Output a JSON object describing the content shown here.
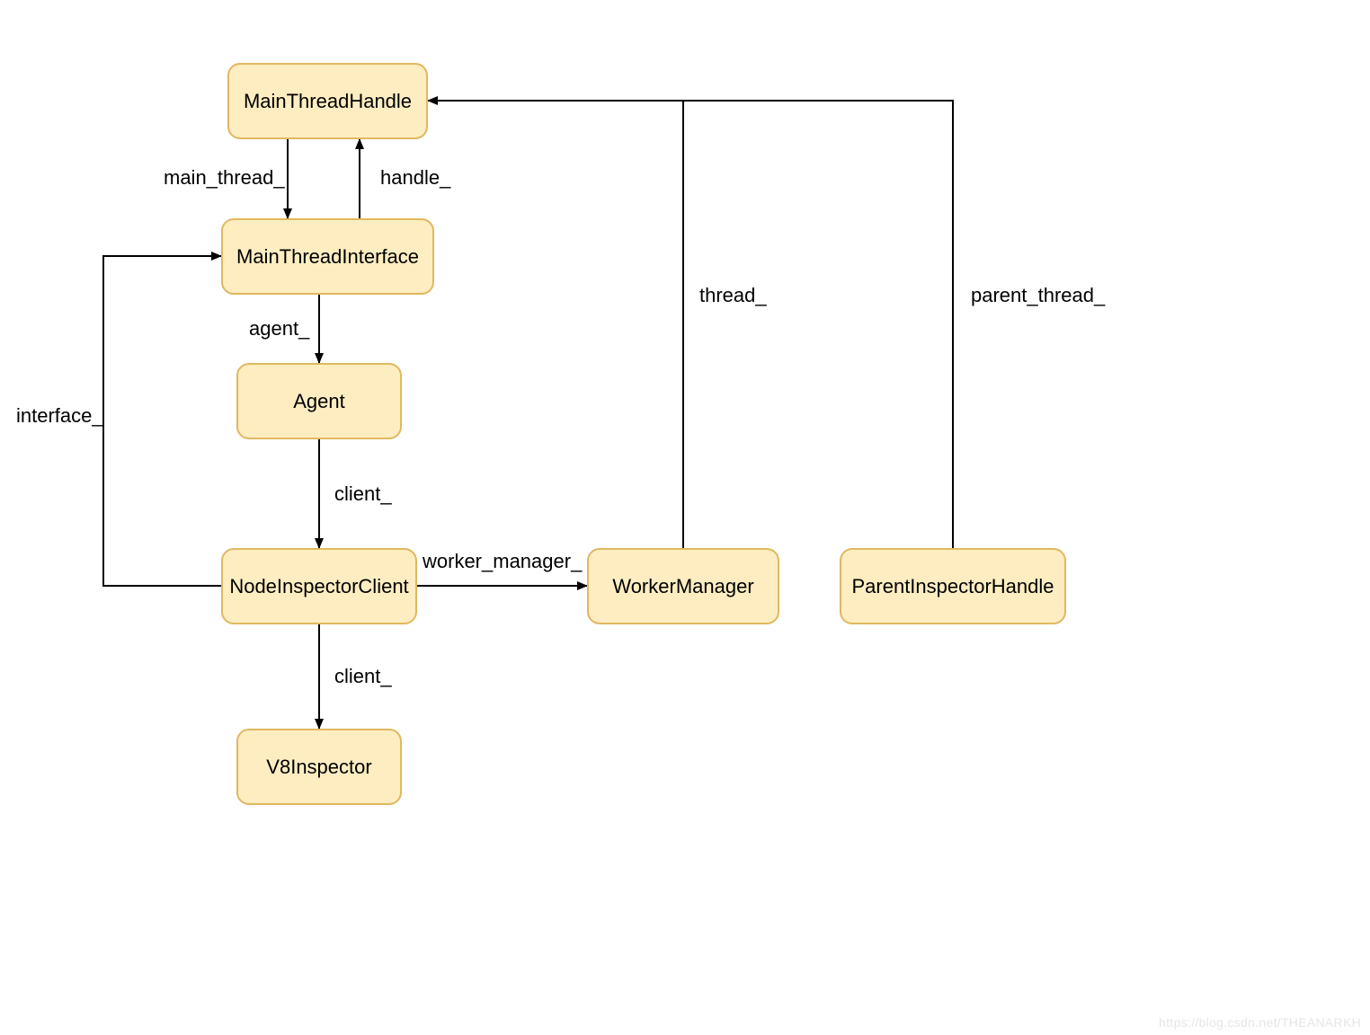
{
  "chart_data": {
    "type": "diagram",
    "title": "",
    "nodes": [
      {
        "id": "MainThreadHandle",
        "label": "MainThreadHandle"
      },
      {
        "id": "MainThreadInterface",
        "label": "MainThreadInterface"
      },
      {
        "id": "Agent",
        "label": "Agent"
      },
      {
        "id": "NodeInspectorClient",
        "label": "NodeInspectorClient"
      },
      {
        "id": "V8Inspector",
        "label": "V8Inspector"
      },
      {
        "id": "WorkerManager",
        "label": "WorkerManager"
      },
      {
        "id": "ParentInspectorHandle",
        "label": "ParentInspectorHandle"
      }
    ],
    "edges": [
      {
        "from": "MainThreadHandle",
        "to": "MainThreadInterface",
        "label": "main_thread_"
      },
      {
        "from": "MainThreadInterface",
        "to": "MainThreadHandle",
        "label": "handle_"
      },
      {
        "from": "MainThreadInterface",
        "to": "Agent",
        "label": "agent_"
      },
      {
        "from": "Agent",
        "to": "NodeInspectorClient",
        "label": "client_"
      },
      {
        "from": "NodeInspectorClient",
        "to": "MainThreadInterface",
        "label": "interface_"
      },
      {
        "from": "NodeInspectorClient",
        "to": "WorkerManager",
        "label": "worker_manager_"
      },
      {
        "from": "NodeInspectorClient",
        "to": "V8Inspector",
        "label": "client_"
      },
      {
        "from": "WorkerManager",
        "to": "MainThreadHandle",
        "label": "thread_"
      },
      {
        "from": "ParentInspectorHandle",
        "to": "MainThreadHandle",
        "label": "parent_thread_"
      }
    ]
  },
  "nodes": {
    "main_thread_handle": "MainThreadHandle",
    "main_thread_interface": "MainThreadInterface",
    "agent": "Agent",
    "node_inspector_client": "NodeInspectorClient",
    "v8_inspector": "V8Inspector",
    "worker_manager": "WorkerManager",
    "parent_inspector_handle": "ParentInspectorHandle"
  },
  "labels": {
    "main_thread": "main_thread_",
    "handle": "handle_",
    "agent": "agent_",
    "client1": "client_",
    "interface": "interface_",
    "worker_manager": "worker_manager_",
    "client2": "client_",
    "thread": "thread_",
    "parent_thread": "parent_thread_"
  },
  "watermark": "https://blog.csdn.net/THEANARKH"
}
